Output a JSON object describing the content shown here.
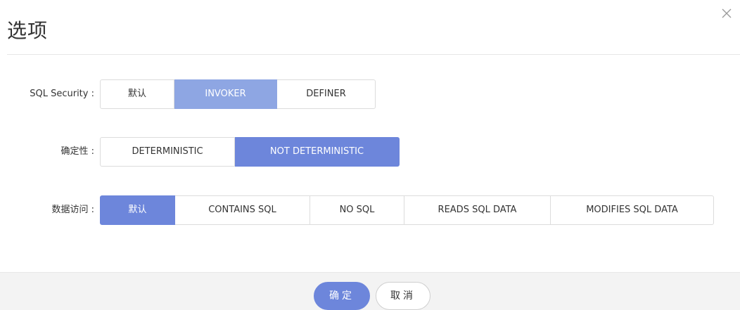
{
  "dialog": {
    "title": "选项",
    "close_icon": "close-icon"
  },
  "rows": [
    {
      "label": "SQL Security :",
      "options": [
        "默认",
        "INVOKER",
        "DEFINER"
      ],
      "selected": "INVOKER"
    },
    {
      "label": "确定性 :",
      "options": [
        "DETERMINISTIC",
        "NOT DETERMINISTIC"
      ],
      "selected": "NOT DETERMINISTIC"
    },
    {
      "label": "数据访问 :",
      "options": [
        "默认",
        "CONTAINS SQL",
        "NO SQL",
        "READS SQL DATA",
        "MODIFIES SQL DATA"
      ],
      "selected": "默认"
    }
  ],
  "footer": {
    "ok_label": "确定",
    "cancel_label": "取消"
  },
  "colors": {
    "accent": "#6d86db",
    "accent_light": "#8ea6e3"
  }
}
